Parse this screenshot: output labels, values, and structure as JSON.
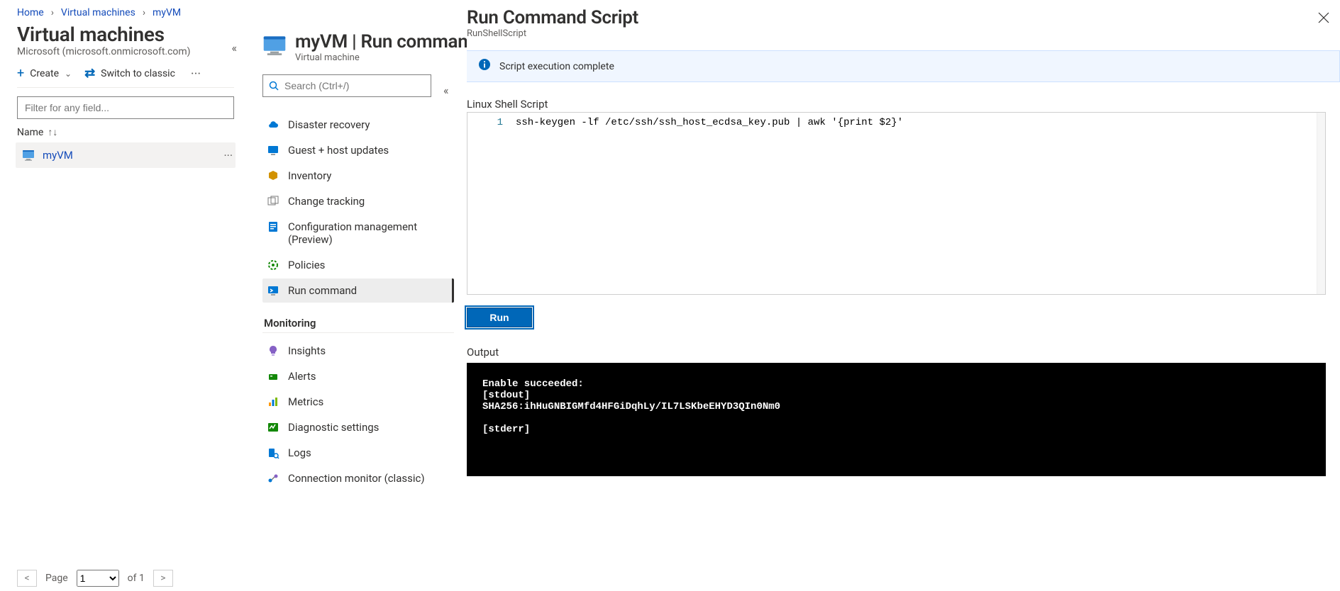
{
  "breadcrumb": [
    {
      "label": "Home"
    },
    {
      "label": "Virtual machines"
    },
    {
      "label": "myVM"
    }
  ],
  "sep": "›",
  "list_pane": {
    "title": "Virtual machines",
    "tenant": "Microsoft (microsoft.onmicrosoft.com)",
    "create": "Create",
    "switch": "Switch to classic",
    "filter_placeholder": "Filter for any field...",
    "column": "Name",
    "sort": "↑↓",
    "rows": [
      {
        "name": "myVM"
      }
    ],
    "pager": {
      "page_label": "Page",
      "page": "1",
      "of": "of 1"
    }
  },
  "vm_pane": {
    "title": "myVM | Run command",
    "subtitle": "Virtual machine",
    "search_placeholder": "Search (Ctrl+/)",
    "groups": {
      "operations": [
        {
          "icon": "cloud",
          "color": "#0078d4",
          "label": "Disaster recovery"
        },
        {
          "icon": "updates",
          "color": "#0078d4",
          "label": "Guest + host updates"
        },
        {
          "icon": "box",
          "color": "#d29200",
          "label": "Inventory"
        },
        {
          "icon": "track",
          "color": "#7a7a7a",
          "label": "Change tracking"
        },
        {
          "icon": "doc",
          "color": "#0078d4",
          "label": "Configuration management (Preview)"
        },
        {
          "icon": "shield",
          "color": "#138808",
          "label": "Policies"
        },
        {
          "icon": "run",
          "color": "#0078d4",
          "label": "Run command",
          "active": true
        }
      ],
      "monitoring_header": "Monitoring",
      "monitoring": [
        {
          "icon": "bulb",
          "color": "#8661c5",
          "label": "Insights"
        },
        {
          "icon": "alert",
          "color": "#138808",
          "label": "Alerts"
        },
        {
          "icon": "chart",
          "color": "#0078d4",
          "label": "Metrics"
        },
        {
          "icon": "diag",
          "color": "#138808",
          "label": "Diagnostic settings"
        },
        {
          "icon": "logs",
          "color": "#0078d4",
          "label": "Logs"
        },
        {
          "icon": "conn",
          "color": "#0078d4",
          "label": "Connection monitor (classic)"
        }
      ]
    }
  },
  "rcs": {
    "title": "Run Command Script",
    "subtitle": "RunShellScript",
    "banner": "Script execution complete",
    "editor_label": "Linux Shell Script",
    "line_no": "1",
    "script": "ssh-keygen -lf /etc/ssh/ssh_host_ecdsa_key.pub | awk '{print $2}'",
    "run": "Run",
    "output_label": "Output",
    "console": "Enable succeeded: \n[stdout]\nSHA256:ihHuGNBIGMfd4HFGiDqhLy/IL7LSKbeEHYD3QIn0Nm0\n\n[stderr]"
  },
  "colors": {
    "accent": "#0067b8"
  }
}
